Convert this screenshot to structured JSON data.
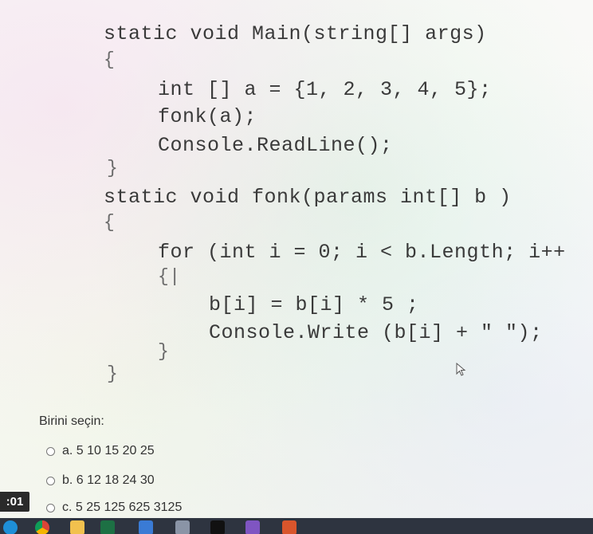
{
  "code": {
    "lines": [
      "static void Main(string[] args)",
      "{",
      "int [] a = {1, 2, 3, 4, 5};",
      "fonk(a);",
      "Console.ReadLine();",
      "}",
      "static void fonk(params int[] b )",
      "{",
      "for (int i = 0; i < b.Length; i++",
      "{|",
      "b[i] = b[i] * 5 ;",
      "Console.Write (b[i] + \" \");",
      "}",
      "}"
    ]
  },
  "question": {
    "prompt": "Birini seçin:",
    "options": [
      {
        "label": "a. 5 10 15 20 25"
      },
      {
        "label": "b. 6 12 18 24 30"
      },
      {
        "label": "c. 5 25 125 625 3125"
      }
    ]
  },
  "timer": {
    "text": ":01"
  },
  "taskbar": {
    "icons": [
      "edge-icon",
      "chrome-icon",
      "file-explorer-icon",
      "excel-icon",
      "app-icon",
      "box-icon",
      "terminal-icon",
      "visual-studio-icon",
      "app-icon-2"
    ]
  },
  "colors": {
    "code_text": "#3a3a3a",
    "taskbar": "#2e3440",
    "timer_bg": "#2a2a2a"
  }
}
